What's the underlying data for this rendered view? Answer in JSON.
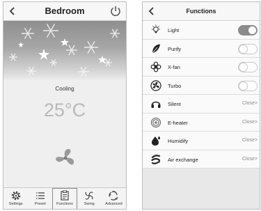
{
  "left": {
    "title": "Bedroom",
    "mode": "Cooling",
    "temperature": "25°C",
    "nav": [
      {
        "label": "Settings",
        "icon": "gear-icon",
        "active": false
      },
      {
        "label": "Preset",
        "icon": "list-icon",
        "active": false
      },
      {
        "label": "Functions",
        "icon": "clipboard-icon",
        "active": true
      },
      {
        "label": "Swing",
        "icon": "swing-icon",
        "active": false
      },
      {
        "label": "Advanced",
        "icon": "recycle-icon",
        "active": false
      }
    ]
  },
  "right": {
    "title": "Functions",
    "items": [
      {
        "label": "Light",
        "icon": "bulb-icon",
        "type": "toggle",
        "on": true
      },
      {
        "label": "Purify",
        "icon": "leaf-icon",
        "type": "toggle",
        "on": false
      },
      {
        "label": "X-fan",
        "icon": "flower-fan-icon",
        "type": "toggle",
        "on": false
      },
      {
        "label": "Turbo",
        "icon": "turbo-icon",
        "type": "toggle",
        "on": false
      },
      {
        "label": "Silent",
        "icon": "headphones-icon",
        "type": "value",
        "value": "Close>"
      },
      {
        "label": "E-heater",
        "icon": "heater-icon",
        "type": "value",
        "value": "Close>"
      },
      {
        "label": "Humidify",
        "icon": "humidify-icon",
        "type": "value",
        "value": "Close>"
      },
      {
        "label": "Air exchange",
        "icon": "air-exchange-icon",
        "type": "value",
        "value": "Close>"
      }
    ]
  }
}
